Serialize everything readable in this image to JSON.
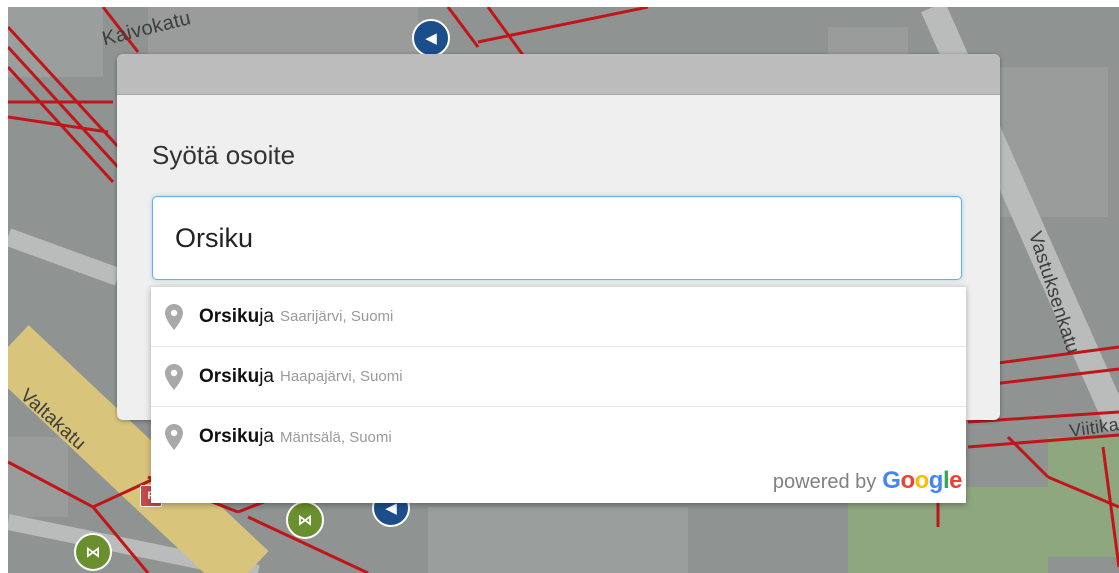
{
  "map": {
    "street_labels": {
      "kaivokatu": "Kaivokatu",
      "valtakatu": "Valtakatu",
      "vastuksen": "Vastuksenkatu",
      "viitikan": "Viitikan"
    },
    "colors": {
      "base": "#8f9392",
      "route": "#c0161a",
      "road_yellow": "#d9c47c",
      "park": "#8fa77f"
    }
  },
  "modal": {
    "title": "Syötä osoite",
    "address_input": {
      "value": "Orsiku",
      "placeholder": ""
    }
  },
  "autocomplete": {
    "items": [
      {
        "match": "Orsiku",
        "rest": "ja",
        "secondary": "Saarijärvi, Suomi",
        "icon": "map-pin-icon"
      },
      {
        "match": "Orsiku",
        "rest": "ja",
        "secondary": "Haapajärvi, Suomi",
        "icon": "map-pin-icon"
      },
      {
        "match": "Orsiku",
        "rest": "ja",
        "secondary": "Mäntsälä, Suomi",
        "icon": "map-pin-icon"
      }
    ],
    "footer": {
      "powered_by": "powered by",
      "brand": [
        "G",
        "o",
        "o",
        "g",
        "l",
        "e"
      ],
      "brand_colors": [
        "#4285F4",
        "#EA4335",
        "#FBBC05",
        "#4285F4",
        "#34A853",
        "#EA4335"
      ]
    }
  }
}
